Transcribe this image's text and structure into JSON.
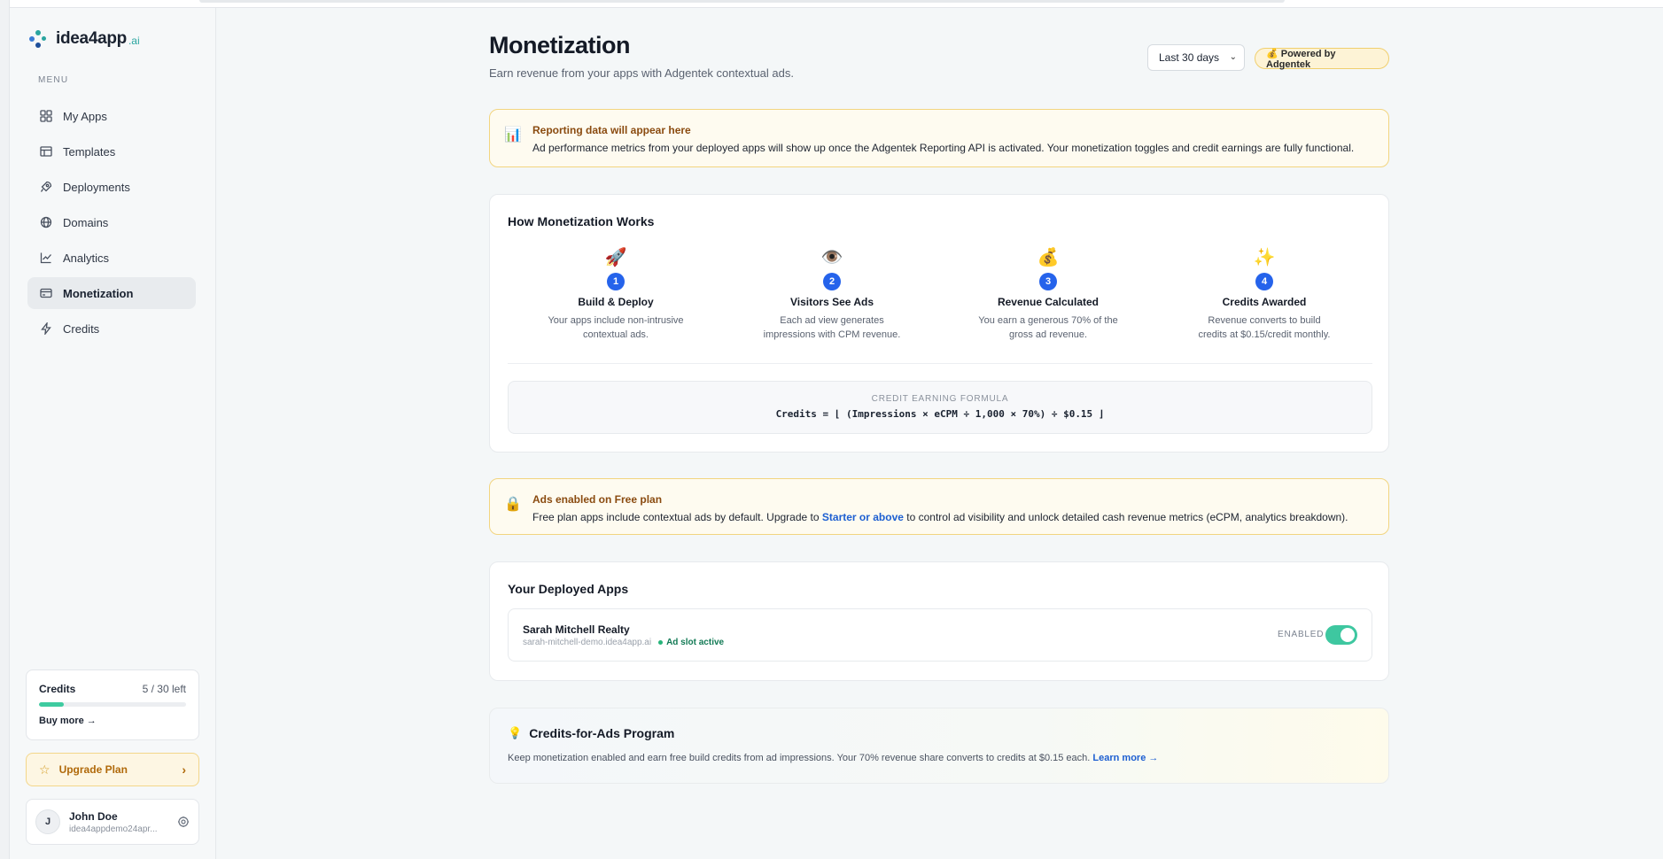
{
  "brand": {
    "name": "idea4app",
    "suffix": ".ai"
  },
  "sidebar": {
    "menu_heading": "MENU",
    "items": [
      {
        "label": "My Apps",
        "icon": "grid-icon"
      },
      {
        "label": "Templates",
        "icon": "template-icon"
      },
      {
        "label": "Deployments",
        "icon": "rocket-icon"
      },
      {
        "label": "Domains",
        "icon": "globe-icon"
      },
      {
        "label": "Analytics",
        "icon": "chart-line-icon"
      },
      {
        "label": "Monetization",
        "icon": "card-icon",
        "active": true
      },
      {
        "label": "Credits",
        "icon": "bolt-icon"
      }
    ],
    "credits": {
      "title": "Credits",
      "left": "5 / 30 left",
      "used_fraction": 0.1667,
      "buy_more": "Buy more →"
    },
    "upgrade": {
      "label": "Upgrade Plan"
    },
    "user": {
      "initial": "J",
      "name": "John Doe",
      "email": "idea4appdemo24apr..."
    }
  },
  "header": {
    "title": "Monetization",
    "subtitle": "Earn revenue from your apps with Adgentek contextual ads.",
    "range": "Last 30 days",
    "powered": "💰 Powered by Adgentek"
  },
  "reporting_notice": {
    "icon": "📊",
    "title": "Reporting data will appear here",
    "text": "Ad performance metrics from your deployed apps will show up once the Adgentek Reporting API is activated. Your monetization toggles and credit earnings are fully functional."
  },
  "how_it_works": {
    "title": "How Monetization Works",
    "steps": [
      {
        "emoji": "🚀",
        "num": "1",
        "title": "Build & Deploy",
        "desc": "Your apps include non-intrusive contextual ads."
      },
      {
        "emoji": "👁️",
        "num": "2",
        "title": "Visitors See Ads",
        "desc": "Each ad view generates impressions with CPM revenue."
      },
      {
        "emoji": "💰",
        "num": "3",
        "title": "Revenue Calculated",
        "desc": "You earn a generous 70% of the gross ad revenue."
      },
      {
        "emoji": "✨",
        "num": "4",
        "title": "Credits Awarded",
        "desc": "Revenue converts to build credits at $0.15/credit monthly."
      }
    ],
    "formula_label": "CREDIT EARNING FORMULA",
    "formula": "Credits = ⌊ (Impressions × eCPM ÷ 1,000 × 70%) ÷ $0.15 ⌋"
  },
  "free_plan_notice": {
    "icon": "🔒",
    "title": "Ads enabled on Free plan",
    "text_before": "Free plan apps include contextual ads by default. Upgrade to ",
    "link": "Starter or above",
    "text_after": " to control ad visibility and unlock detailed cash revenue metrics (eCPM, analytics breakdown)."
  },
  "deployed_apps": {
    "title": "Your Deployed Apps",
    "apps": [
      {
        "name": "Sarah Mitchell Realty",
        "domain": "sarah-mitchell-demo.idea4app.ai",
        "status": "Ad slot active",
        "toggle_label": "ENABLED",
        "enabled": true
      }
    ]
  },
  "program": {
    "icon": "💡",
    "title": "Credits-for-Ads Program",
    "text": "Keep monetization enabled and earn free build credits from ad impressions. Your 70% revenue share converts to credits at $0.15 each. ",
    "link": "Learn more →"
  },
  "colors": {
    "accent": "#2563eb",
    "toggle_on": "#3ec7a0",
    "warning_border": "#f2d580",
    "link": "#1d5fd1"
  }
}
